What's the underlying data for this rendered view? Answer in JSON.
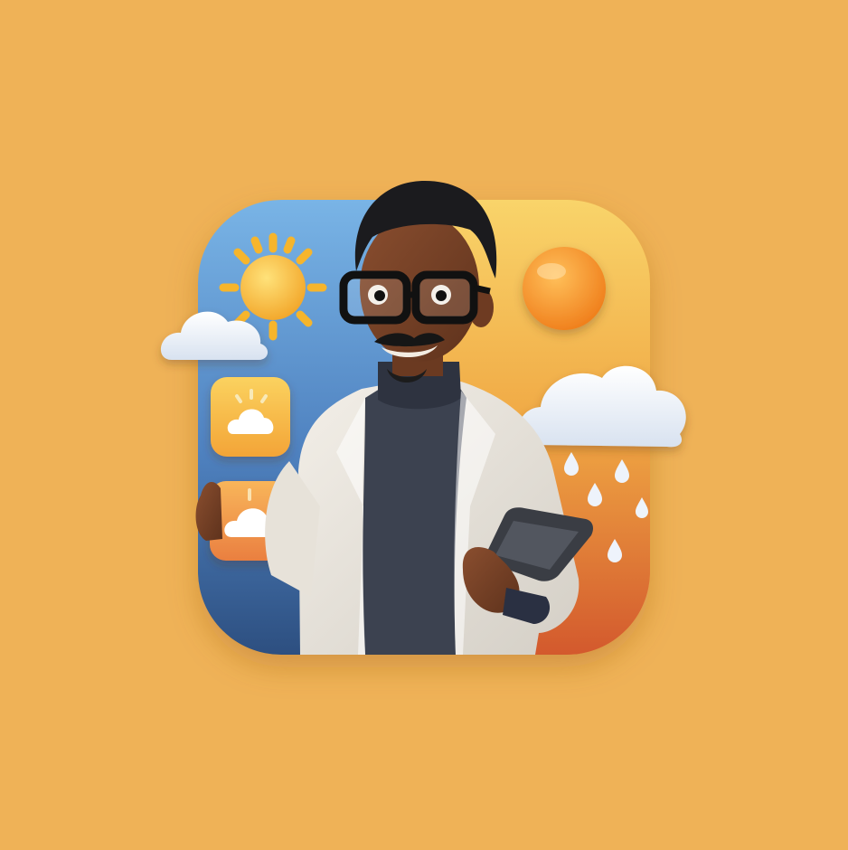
{
  "illustration": {
    "background_color": "#efb257",
    "icon_tile": {
      "left_gradient": [
        "#6aa7df",
        "#2f5488"
      ],
      "right_gradient": [
        "#f8cf64",
        "#d6622f"
      ]
    },
    "icons": [
      "sun-icon",
      "small-cloud-icon",
      "orange-sun-icon",
      "rain-cloud-icon",
      "raindrop-icon",
      "weather-app-icon-sun-cloud",
      "weather-app-icon-cloud",
      "smartphone-icon"
    ],
    "character": {
      "description_tags": [
        "glasses",
        "mustache",
        "lab-coat",
        "turtleneck",
        "holding-phone"
      ]
    }
  }
}
